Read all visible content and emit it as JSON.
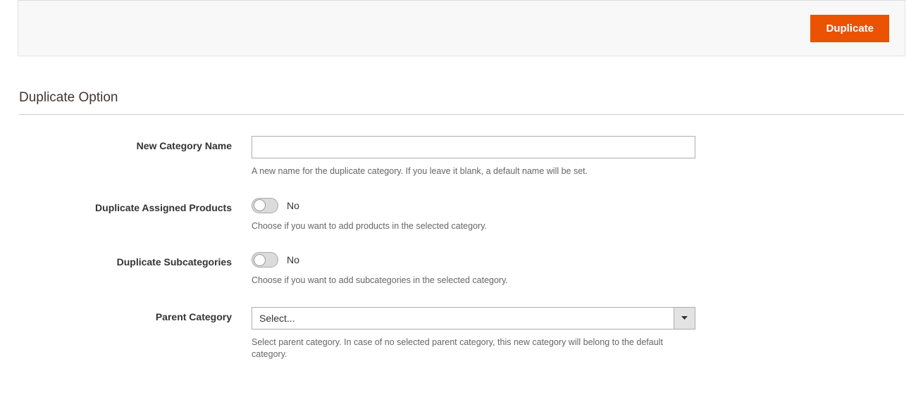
{
  "header": {
    "duplicate_button": "Duplicate"
  },
  "section": {
    "title": "Duplicate Option"
  },
  "fields": {
    "new_category_name": {
      "label": "New Category Name",
      "value": "",
      "helper": "A new name for the duplicate category. If you leave it blank, a default name will be set."
    },
    "duplicate_products": {
      "label": "Duplicate Assigned Products",
      "value_label": "No",
      "helper": "Choose if you want to add products in the selected category."
    },
    "duplicate_subcategories": {
      "label": "Duplicate Subcategories",
      "value_label": "No",
      "helper": "Choose if you want to add subcategories in the selected category."
    },
    "parent_category": {
      "label": "Parent Category",
      "selected": "Select...",
      "helper": "Select parent category. In case of no selected parent category, this new category will belong to the default category."
    }
  }
}
